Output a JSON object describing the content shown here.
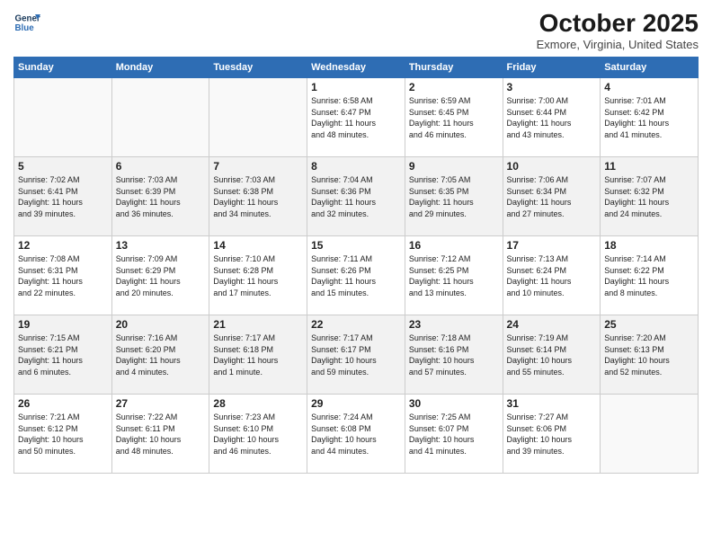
{
  "header": {
    "logo_line1": "General",
    "logo_line2": "Blue",
    "month": "October 2025",
    "location": "Exmore, Virginia, United States"
  },
  "weekdays": [
    "Sunday",
    "Monday",
    "Tuesday",
    "Wednesday",
    "Thursday",
    "Friday",
    "Saturday"
  ],
  "weeks": [
    [
      {
        "day": "",
        "info": ""
      },
      {
        "day": "",
        "info": ""
      },
      {
        "day": "",
        "info": ""
      },
      {
        "day": "1",
        "info": "Sunrise: 6:58 AM\nSunset: 6:47 PM\nDaylight: 11 hours\nand 48 minutes."
      },
      {
        "day": "2",
        "info": "Sunrise: 6:59 AM\nSunset: 6:45 PM\nDaylight: 11 hours\nand 46 minutes."
      },
      {
        "day": "3",
        "info": "Sunrise: 7:00 AM\nSunset: 6:44 PM\nDaylight: 11 hours\nand 43 minutes."
      },
      {
        "day": "4",
        "info": "Sunrise: 7:01 AM\nSunset: 6:42 PM\nDaylight: 11 hours\nand 41 minutes."
      }
    ],
    [
      {
        "day": "5",
        "info": "Sunrise: 7:02 AM\nSunset: 6:41 PM\nDaylight: 11 hours\nand 39 minutes."
      },
      {
        "day": "6",
        "info": "Sunrise: 7:03 AM\nSunset: 6:39 PM\nDaylight: 11 hours\nand 36 minutes."
      },
      {
        "day": "7",
        "info": "Sunrise: 7:03 AM\nSunset: 6:38 PM\nDaylight: 11 hours\nand 34 minutes."
      },
      {
        "day": "8",
        "info": "Sunrise: 7:04 AM\nSunset: 6:36 PM\nDaylight: 11 hours\nand 32 minutes."
      },
      {
        "day": "9",
        "info": "Sunrise: 7:05 AM\nSunset: 6:35 PM\nDaylight: 11 hours\nand 29 minutes."
      },
      {
        "day": "10",
        "info": "Sunrise: 7:06 AM\nSunset: 6:34 PM\nDaylight: 11 hours\nand 27 minutes."
      },
      {
        "day": "11",
        "info": "Sunrise: 7:07 AM\nSunset: 6:32 PM\nDaylight: 11 hours\nand 24 minutes."
      }
    ],
    [
      {
        "day": "12",
        "info": "Sunrise: 7:08 AM\nSunset: 6:31 PM\nDaylight: 11 hours\nand 22 minutes."
      },
      {
        "day": "13",
        "info": "Sunrise: 7:09 AM\nSunset: 6:29 PM\nDaylight: 11 hours\nand 20 minutes."
      },
      {
        "day": "14",
        "info": "Sunrise: 7:10 AM\nSunset: 6:28 PM\nDaylight: 11 hours\nand 17 minutes."
      },
      {
        "day": "15",
        "info": "Sunrise: 7:11 AM\nSunset: 6:26 PM\nDaylight: 11 hours\nand 15 minutes."
      },
      {
        "day": "16",
        "info": "Sunrise: 7:12 AM\nSunset: 6:25 PM\nDaylight: 11 hours\nand 13 minutes."
      },
      {
        "day": "17",
        "info": "Sunrise: 7:13 AM\nSunset: 6:24 PM\nDaylight: 11 hours\nand 10 minutes."
      },
      {
        "day": "18",
        "info": "Sunrise: 7:14 AM\nSunset: 6:22 PM\nDaylight: 11 hours\nand 8 minutes."
      }
    ],
    [
      {
        "day": "19",
        "info": "Sunrise: 7:15 AM\nSunset: 6:21 PM\nDaylight: 11 hours\nand 6 minutes."
      },
      {
        "day": "20",
        "info": "Sunrise: 7:16 AM\nSunset: 6:20 PM\nDaylight: 11 hours\nand 4 minutes."
      },
      {
        "day": "21",
        "info": "Sunrise: 7:17 AM\nSunset: 6:18 PM\nDaylight: 11 hours\nand 1 minute."
      },
      {
        "day": "22",
        "info": "Sunrise: 7:17 AM\nSunset: 6:17 PM\nDaylight: 10 hours\nand 59 minutes."
      },
      {
        "day": "23",
        "info": "Sunrise: 7:18 AM\nSunset: 6:16 PM\nDaylight: 10 hours\nand 57 minutes."
      },
      {
        "day": "24",
        "info": "Sunrise: 7:19 AM\nSunset: 6:14 PM\nDaylight: 10 hours\nand 55 minutes."
      },
      {
        "day": "25",
        "info": "Sunrise: 7:20 AM\nSunset: 6:13 PM\nDaylight: 10 hours\nand 52 minutes."
      }
    ],
    [
      {
        "day": "26",
        "info": "Sunrise: 7:21 AM\nSunset: 6:12 PM\nDaylight: 10 hours\nand 50 minutes."
      },
      {
        "day": "27",
        "info": "Sunrise: 7:22 AM\nSunset: 6:11 PM\nDaylight: 10 hours\nand 48 minutes."
      },
      {
        "day": "28",
        "info": "Sunrise: 7:23 AM\nSunset: 6:10 PM\nDaylight: 10 hours\nand 46 minutes."
      },
      {
        "day": "29",
        "info": "Sunrise: 7:24 AM\nSunset: 6:08 PM\nDaylight: 10 hours\nand 44 minutes."
      },
      {
        "day": "30",
        "info": "Sunrise: 7:25 AM\nSunset: 6:07 PM\nDaylight: 10 hours\nand 41 minutes."
      },
      {
        "day": "31",
        "info": "Sunrise: 7:27 AM\nSunset: 6:06 PM\nDaylight: 10 hours\nand 39 minutes."
      },
      {
        "day": "",
        "info": ""
      }
    ]
  ]
}
